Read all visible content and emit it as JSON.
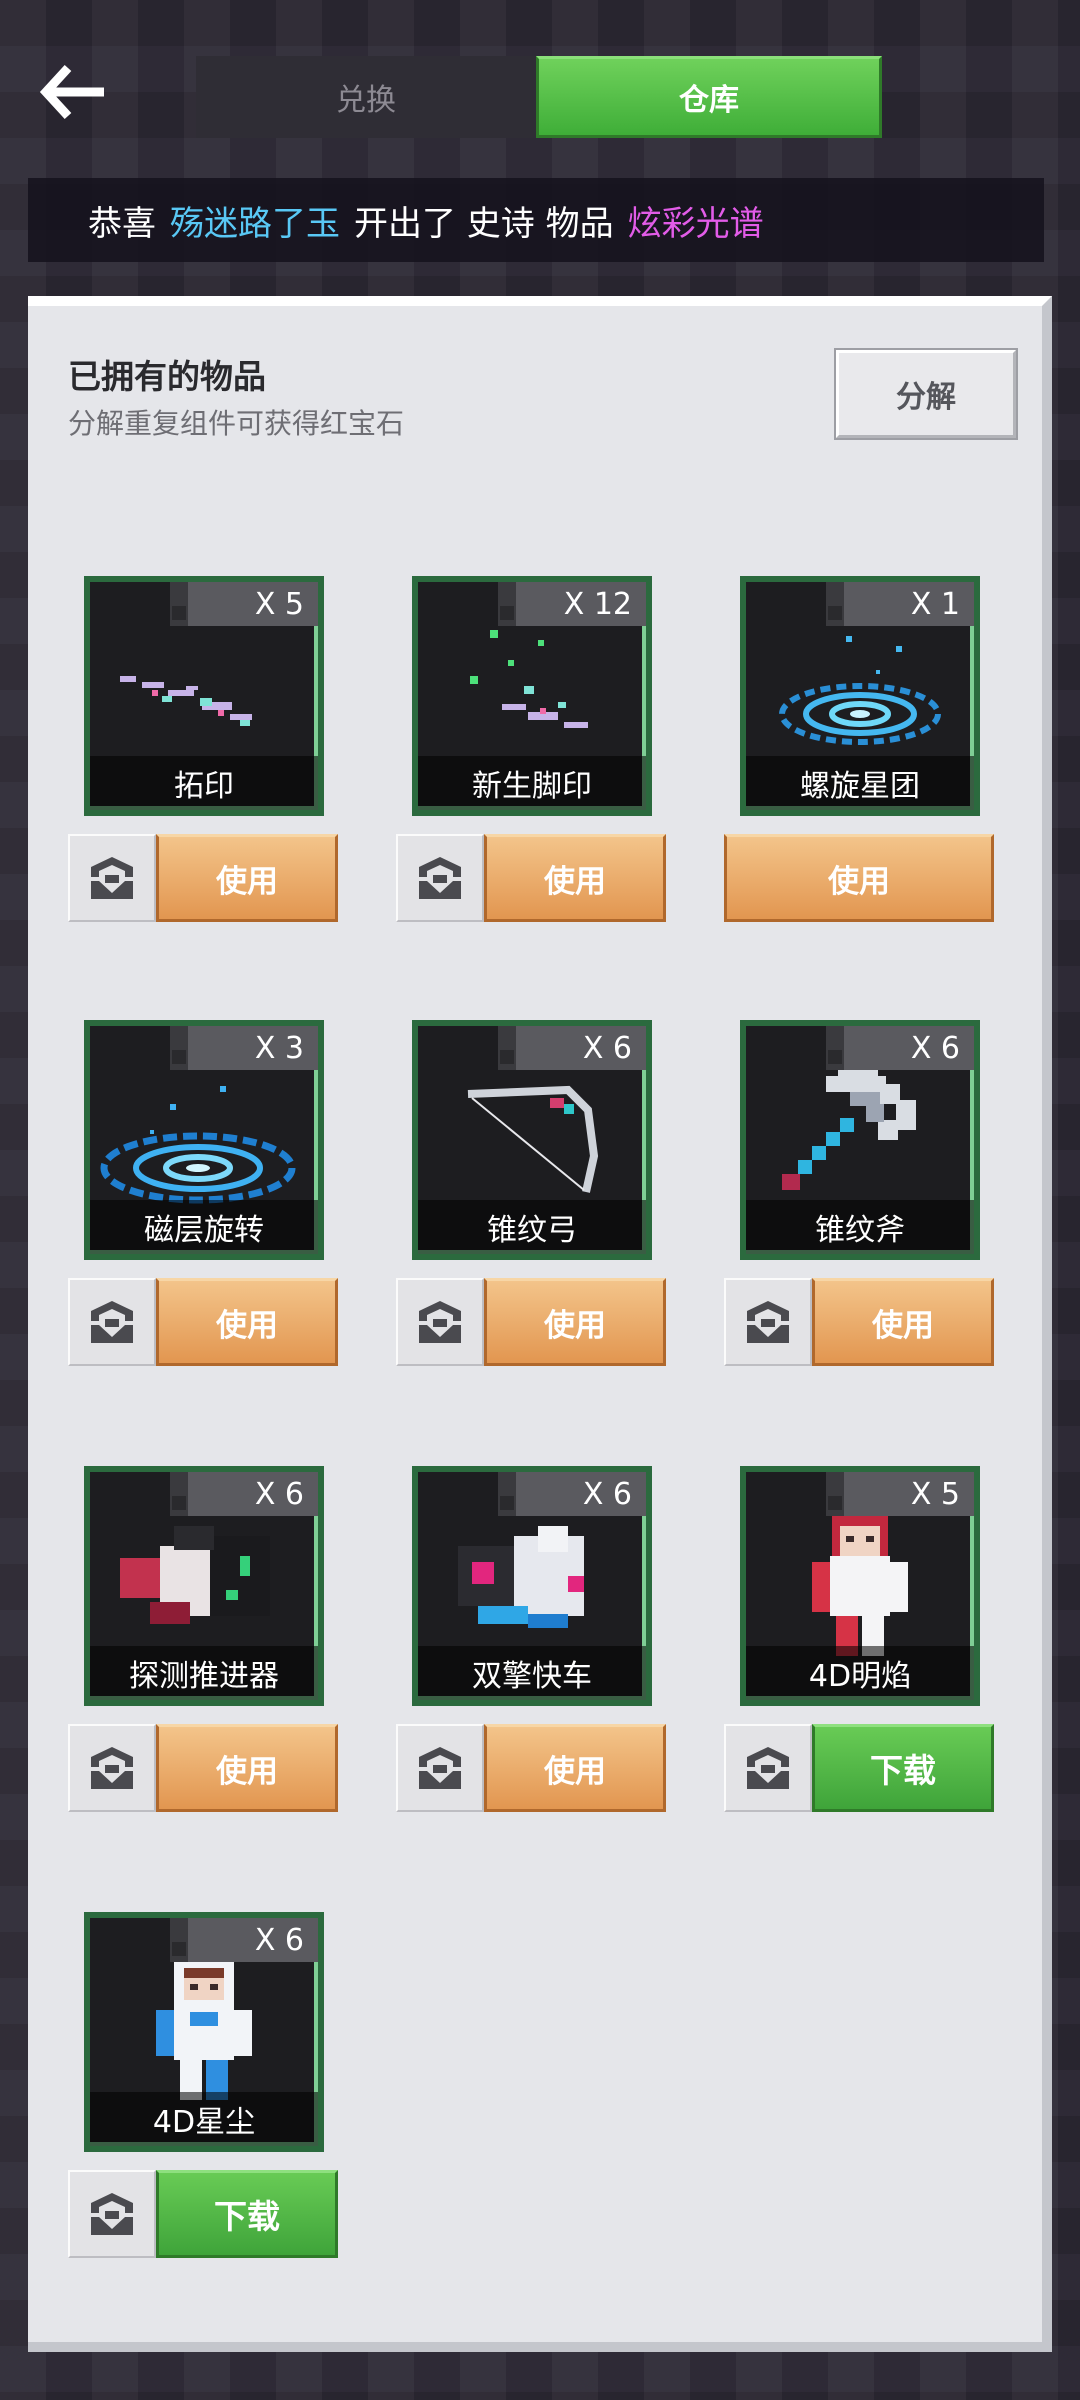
{
  "header": {
    "tabs": [
      {
        "label": "兑换",
        "active": false
      },
      {
        "label": "仓库",
        "active": true
      }
    ]
  },
  "announcement": {
    "prefix": "恭喜",
    "player": "殇迷路了玉",
    "middle": "开出了 史诗 物品",
    "item": "炫彩光谱",
    "colors": {
      "player": "#59c8f5",
      "item": "#e25ce8"
    }
  },
  "panel": {
    "title": "已拥有的物品",
    "subtitle": "分解重复组件可获得红宝石",
    "decompose_label": "分解"
  },
  "items": [
    {
      "name": "拓印",
      "qty": "X 5",
      "action": "使用",
      "has_preview": true,
      "art": "footprint-effect-icon"
    },
    {
      "name": "新生脚印",
      "qty": "X 12",
      "action": "使用",
      "has_preview": true,
      "art": "sparkle-footprint-icon"
    },
    {
      "name": "螺旋星团",
      "qty": "X 1",
      "action": "使用",
      "has_preview": false,
      "art": "spiral-nebula-icon"
    },
    {
      "name": "磁层旋转",
      "qty": "X 3",
      "action": "使用",
      "has_preview": true,
      "art": "magnetic-ring-icon"
    },
    {
      "name": "锥纹弓",
      "qty": "X 6",
      "action": "使用",
      "has_preview": true,
      "art": "bow-icon"
    },
    {
      "name": "锥纹斧",
      "qty": "X 6",
      "action": "使用",
      "has_preview": true,
      "art": "axe-icon"
    },
    {
      "name": "探测推进器",
      "qty": "X 6",
      "action": "使用",
      "has_preview": true,
      "art": "thruster-icon"
    },
    {
      "name": "双擎快车",
      "qty": "X 6",
      "action": "使用",
      "has_preview": true,
      "art": "jet-icon"
    },
    {
      "name": "4D明焰",
      "qty": "X 5",
      "action": "下载",
      "has_preview": true,
      "art": "red-skin-icon"
    },
    {
      "name": "4D星尘",
      "qty": "X 6",
      "action": "下载",
      "has_preview": true,
      "art": "blue-skin-icon"
    }
  ]
}
